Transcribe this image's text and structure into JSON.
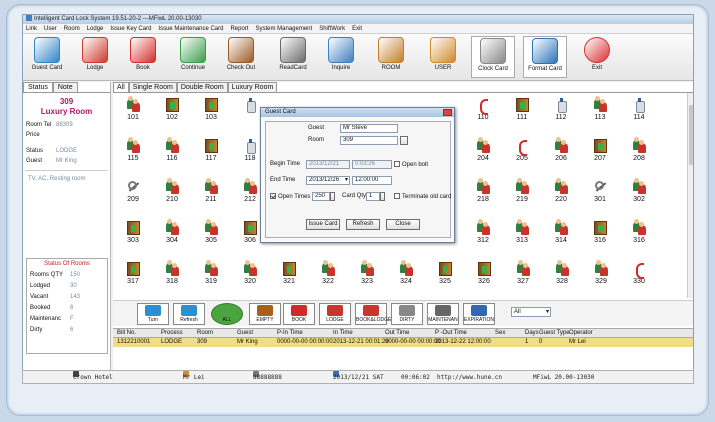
{
  "title_bar": {
    "text": "Intelligent Card Lock System 19.51-20-2 ---MFiwL 20.00-13030"
  },
  "menu": [
    "Link",
    "User",
    "Room",
    "Lodge",
    "Issue Key Card",
    "Issue Maintenance Card",
    "Report",
    "System Management",
    "ShiftWork",
    "Exit"
  ],
  "toolbar": [
    {
      "label": "Guest Card",
      "icon": "guest-card-icon",
      "color": "#2f86c9"
    },
    {
      "label": "Lodge",
      "icon": "lodge-icon",
      "color": "#cf3a2e"
    },
    {
      "label": "Book",
      "icon": "book-phone-icon",
      "color": "#d52c2c"
    },
    {
      "label": "Continue",
      "icon": "continue-icon",
      "color": "#3a9d4a"
    },
    {
      "label": "Check Out",
      "icon": "check-out-icon",
      "color": "#9a5b22"
    },
    {
      "label": "ReadCard",
      "icon": "read-card-icon",
      "color": "#6a6a6a"
    },
    {
      "label": "Inquire",
      "icon": "inquire-icon",
      "color": "#3f7fc0"
    },
    {
      "label": "ROOM",
      "icon": "room-icon",
      "color": "#c47e2a"
    },
    {
      "label": "USER",
      "icon": "user-icon",
      "color": "#d2892b"
    },
    {
      "label": "Clock Card",
      "icon": "clock-card-icon",
      "color": "#888888"
    },
    {
      "label": "Format Card",
      "icon": "format-card-icon",
      "color": "#2d73b8"
    },
    {
      "label": "Exit",
      "icon": "exit-icon",
      "color": "#d93030"
    }
  ],
  "left_panel": {
    "tabs": [
      "Status",
      "Note"
    ],
    "room_number": "309",
    "room_type": "Luxury Room",
    "fields": [
      {
        "k": "Room Tel",
        "v": "88309"
      },
      {
        "k": "Price",
        "v": ""
      },
      {
        "k": "Status",
        "v": "LODGE"
      },
      {
        "k": "Guest",
        "v": "Mr King"
      }
    ],
    "facilities": "TV, AC, Resting room",
    "status_of_rooms": {
      "title": "Status Of Rooms",
      "rows": [
        {
          "k": "Rooms QTY",
          "v": "150"
        },
        {
          "k": "Lodged",
          "v": "30"
        },
        {
          "k": "Vacant",
          "v": "143"
        },
        {
          "k": "Booked",
          "v": "6"
        },
        {
          "k": "Maintenanc",
          "v": "F"
        },
        {
          "k": "Dirty",
          "v": "6"
        }
      ]
    }
  },
  "room_tabs": [
    "All",
    "Single Room",
    "Double Room",
    "Luxury Room"
  ],
  "rooms": [
    {
      "n": "101",
      "t": "people"
    },
    {
      "n": "102",
      "t": "door"
    },
    {
      "n": "103",
      "t": "door"
    },
    {
      "n": "",
      "t": "bottle"
    },
    {
      "n": "110",
      "t": "phone"
    },
    {
      "n": "111",
      "t": "door"
    },
    {
      "n": "112",
      "t": "bottle"
    },
    {
      "n": "113",
      "t": "people"
    },
    {
      "n": "114",
      "t": "bottle"
    },
    {
      "n": "115",
      "t": "people"
    },
    {
      "n": "116",
      "t": "people"
    },
    {
      "n": "117",
      "t": "door"
    },
    {
      "n": "118",
      "t": "bottle"
    },
    {
      "n": "204",
      "t": "people"
    },
    {
      "n": "205",
      "t": "phone"
    },
    {
      "n": "206",
      "t": "people"
    },
    {
      "n": "207",
      "t": "door"
    },
    {
      "n": "208",
      "t": "people"
    },
    {
      "n": "209",
      "t": "tool"
    },
    {
      "n": "210",
      "t": "people"
    },
    {
      "n": "211",
      "t": "people"
    },
    {
      "n": "212",
      "t": "people"
    },
    {
      "n": "218",
      "t": "people"
    },
    {
      "n": "219",
      "t": "people"
    },
    {
      "n": "220",
      "t": "people"
    },
    {
      "n": "301",
      "t": "tool"
    },
    {
      "n": "302",
      "t": "people"
    },
    {
      "n": "303",
      "t": "door"
    },
    {
      "n": "304",
      "t": "people"
    },
    {
      "n": "305",
      "t": "people"
    },
    {
      "n": "306",
      "t": "door"
    },
    {
      "n": "312",
      "t": "people"
    },
    {
      "n": "313",
      "t": "people"
    },
    {
      "n": "314",
      "t": "people"
    },
    {
      "n": "316",
      "t": "door"
    },
    {
      "n": "316",
      "t": "people"
    },
    {
      "n": "317",
      "t": "door"
    },
    {
      "n": "318",
      "t": "people"
    },
    {
      "n": "319",
      "t": "people"
    },
    {
      "n": "320",
      "t": "people"
    },
    {
      "n": "321",
      "t": "door"
    },
    {
      "n": "322",
      "t": "people"
    },
    {
      "n": "323",
      "t": "people"
    },
    {
      "n": "324",
      "t": "people"
    },
    {
      "n": "325",
      "t": "door"
    },
    {
      "n": "326",
      "t": "door"
    },
    {
      "n": "327",
      "t": "people"
    },
    {
      "n": "328",
      "t": "people"
    },
    {
      "n": "329",
      "t": "people"
    },
    {
      "n": "330",
      "t": "phone"
    }
  ],
  "action_buttons": [
    {
      "label": "Turn",
      "color": "#2b8fd1"
    },
    {
      "label": "Refresh",
      "color": "#2b8fd1"
    },
    {
      "label": "ALL",
      "color": "#4aa43f"
    },
    {
      "label": "EMPTY",
      "color": "#a95f20"
    },
    {
      "label": "BOOK",
      "color": "#d12a2a"
    },
    {
      "label": "LODGE",
      "color": "#c9362d"
    },
    {
      "label": "BOOK&LODGE",
      "color": "#c9362d"
    },
    {
      "label": "DIRTY",
      "color": "#888888"
    },
    {
      "label": "MAINTENAN",
      "color": "#666666"
    },
    {
      "label": "EXPIRATION",
      "color": "#3367b0"
    }
  ],
  "filter_select": "All",
  "grid": {
    "headers": [
      "Bill No.",
      "Process",
      "Room",
      "Guest",
      "P-In Time",
      "In Time",
      "Out Time",
      "P -Out Time",
      "Sex",
      "Days",
      "Guest Type",
      "Operator"
    ],
    "rows": [
      [
        "1312210001",
        "LODGE",
        "309",
        "Mr King",
        "0000-00-00 00:00:00",
        "2013-12-21 00:01:29",
        "0000-00-00 00:00:00",
        "2013-12-22 12:00:00",
        "",
        "1",
        "0",
        "Mr Lei"
      ]
    ]
  },
  "dialog": {
    "title": "Guest Card",
    "guest_label": "Guest",
    "guest_value": "Mr Steve",
    "room_label": "Room",
    "room_value": "309",
    "begin_label": "Begin Time",
    "begin_date": "2013/12/21",
    "begin_time": "0:03:26",
    "open_bolt_label": "Open bolt",
    "end_label": "End Time",
    "end_date": "2013/12/26",
    "end_time": "12:00:00",
    "open_times_label": "Open Times",
    "open_times_value": "250",
    "card_qty_label": "Card Qty",
    "card_qty_value": "1",
    "terminate_label": "Terminate old card",
    "issue_button": "Issue Card",
    "refresh_button": "Refresh",
    "close_button": "Close"
  },
  "status_bar": {
    "hotel": "Crown Hotel",
    "user": "Mr Lei",
    "phone": "88888888",
    "date": "2013/12/21 SAT",
    "time": "00:06:02",
    "website": "http://www.hune.cn",
    "version": "MFiwL 20.00-13030"
  }
}
